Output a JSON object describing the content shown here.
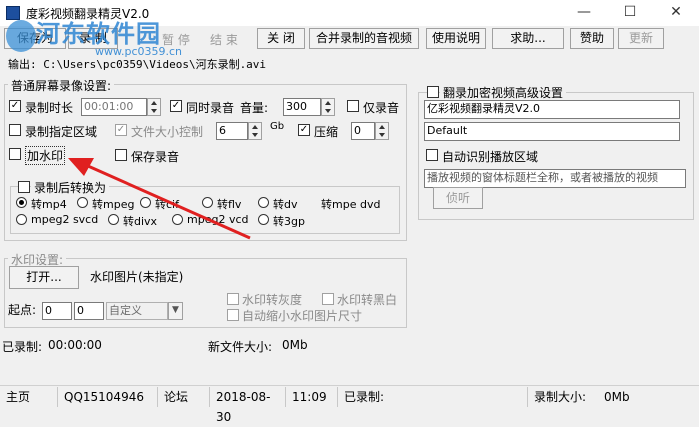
{
  "window": {
    "title": "度彩视频翻录精灵V2.0",
    "minimize": "—",
    "maximize": "☐",
    "close": "✕"
  },
  "watermark": {
    "site": "河东软件园",
    "url": "www.pc0359.cn"
  },
  "toolbar": {
    "save_as": "保存为",
    "record": "录 制",
    "pause": "暂 停",
    "end": "结 束",
    "close": "关 闭",
    "merge": "合并录制的音视频",
    "help": "使用说明",
    "about": "求助...",
    "donate": "赞助",
    "update": "更新"
  },
  "output_path": "输出: C:\\Users\\pc0359\\Videos\\河东录制.avi",
  "screen_settings": {
    "title": "普通屏幕录像设置:",
    "duration_label": "录制时长",
    "duration_value": "00:01:00",
    "audio_label": "同时录音",
    "volume_label": "音量:",
    "volume_value": "300",
    "audio_only_label": "仅录音",
    "region_label": "录制指定区域",
    "filesize_label": "文件大小控制",
    "filesize_value": "6",
    "filesize_unit": "Gb",
    "compress_label": "压缩",
    "compress_value": "0",
    "watermark_label": "加水印",
    "save_audio_label": "保存录音",
    "convert_label": "录制后转换为",
    "formats": [
      "转mp4",
      "转mpeg",
      "转cif",
      "转flv",
      "转dv",
      "转mpe dvd",
      "mpeg2 svcd",
      "转divx",
      "mpeg2 vcd",
      "转3gp"
    ]
  },
  "watermark_settings": {
    "title": "水印设置:",
    "open_button": "打开...",
    "image_label": "水印图片(未指定)",
    "origin_label": "起点:",
    "x_value": "0",
    "y_value": "0",
    "mode_value": "自定义",
    "grayscale_label": "水印转灰度",
    "bw_label": "水印转黑白",
    "autoscale_label": "自动缩小水印图片尺寸"
  },
  "recorded_label": "已录制:",
  "recorded_time": "00:00:00",
  "new_size_label": "新文件大小:",
  "new_size_value": "0Mb",
  "encrypted": {
    "title": "翻录加密视频高级设置",
    "app_name": "亿彩视频翻录精灵V2.0",
    "default_value": "Default",
    "auto_detect_label": "自动识别播放区域",
    "hint": "播放视频的窗体标题栏全称，或者被播放的视频",
    "detect_button": "侦听"
  },
  "statusbar": {
    "home": "主页",
    "qq": "QQ15104946",
    "forum": "论坛",
    "date": "2018-08-30",
    "time": "11:09",
    "recorded": "已录制:",
    "size_label": "录制大小:",
    "size_value": "0Mb"
  }
}
